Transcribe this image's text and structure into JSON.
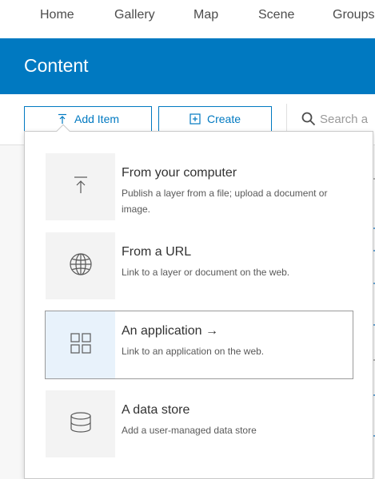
{
  "nav": {
    "links": [
      "Home",
      "Gallery",
      "Map",
      "Scene",
      "Groups"
    ]
  },
  "header": {
    "title": "Content"
  },
  "toolbar": {
    "add_item_label": "Add Item",
    "create_label": "Create",
    "search_placeholder": "Search a"
  },
  "dropdown": {
    "options": [
      {
        "title": "From your computer",
        "description": "Publish a layer from a file; upload a document or image.",
        "icon": "upload-icon"
      },
      {
        "title": "From a URL",
        "description": "Link to a layer or document on the web.",
        "icon": "globe-icon"
      },
      {
        "title": "An application →",
        "description": "Link to an application on the web.",
        "icon": "grid-icon",
        "active": true
      },
      {
        "title": "A data store",
        "description": "Add a user-managed data store",
        "icon": "database-icon"
      }
    ]
  },
  "colors": {
    "brand_blue": "#0079c1",
    "active_tile": "#e8f2fb",
    "tile": "#f3f3f3"
  }
}
